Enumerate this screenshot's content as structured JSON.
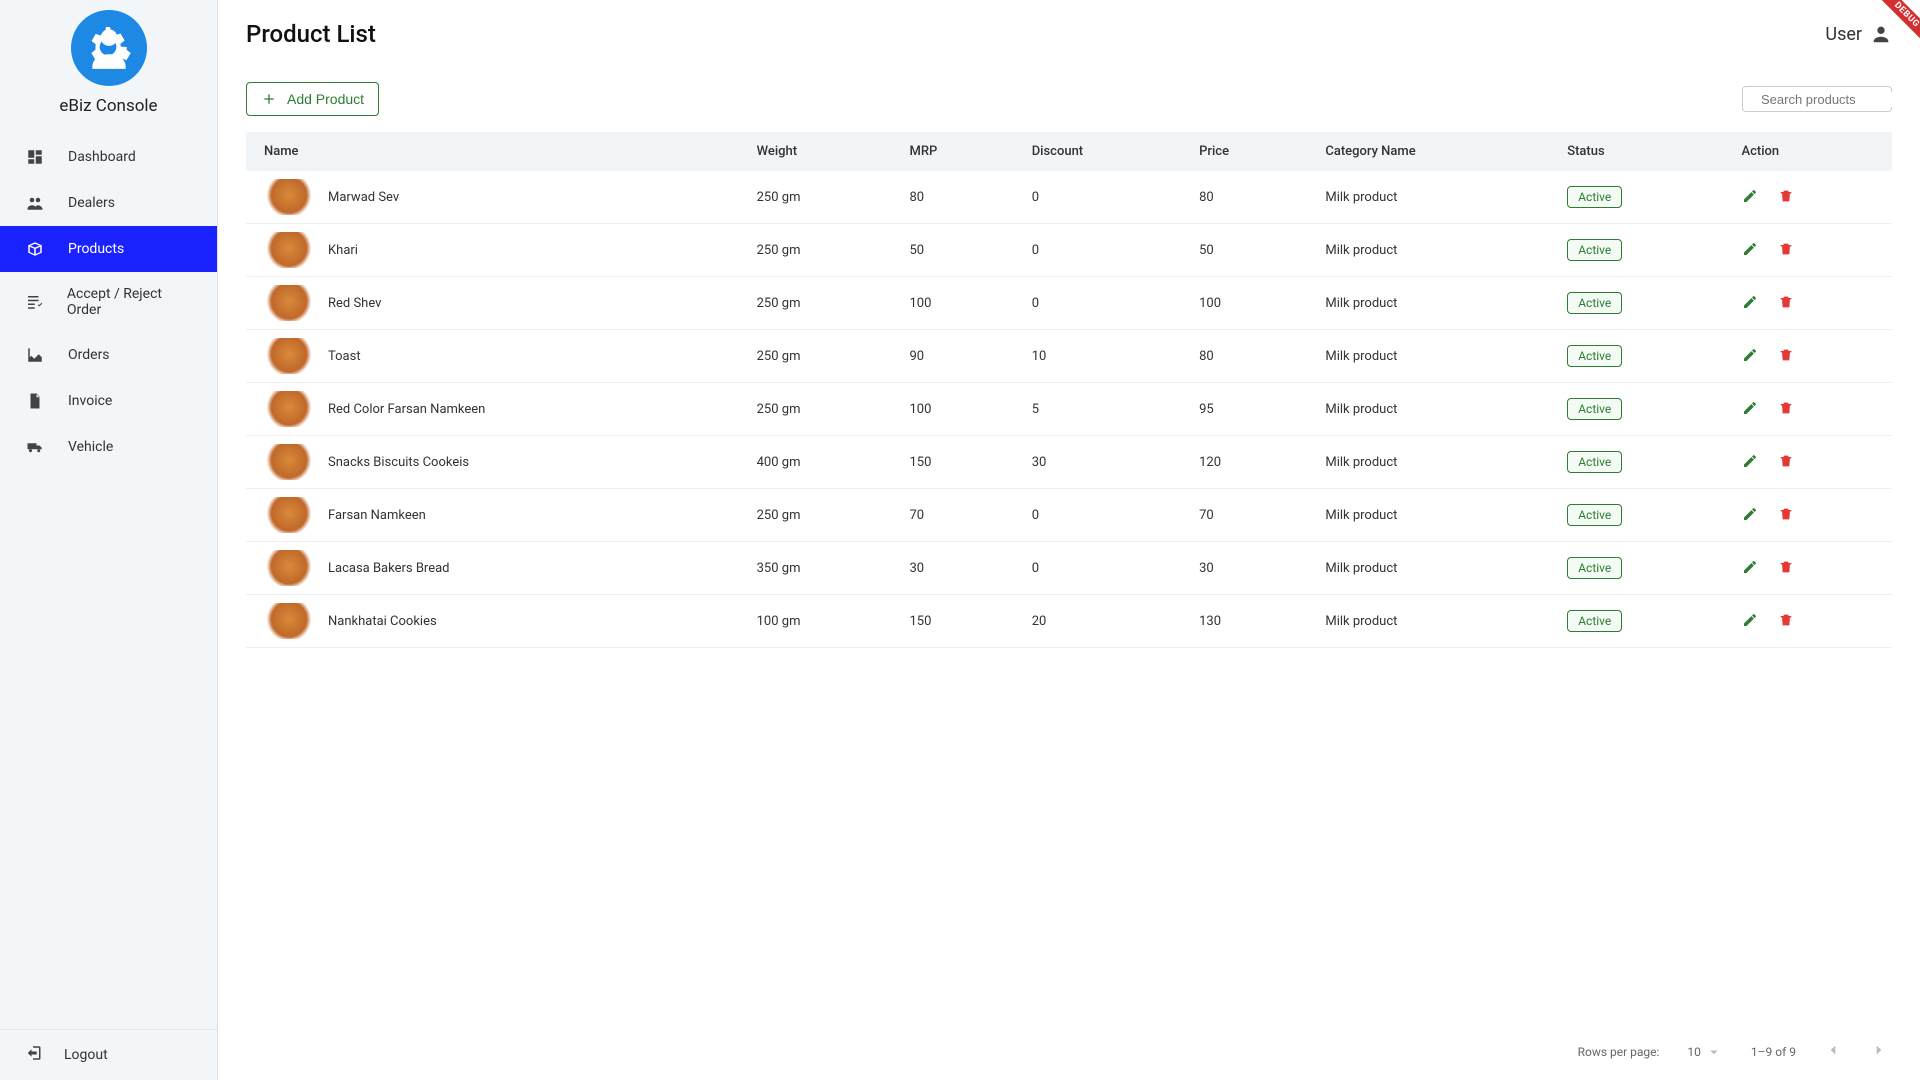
{
  "brand": "eBiz Console",
  "debug_label": "DEBUG",
  "header": {
    "title": "Product List",
    "user_label": "User"
  },
  "sidebar": {
    "items": [
      {
        "label": "Dashboard",
        "icon": "dashboard-icon"
      },
      {
        "label": "Dealers",
        "icon": "people-icon"
      },
      {
        "label": "Products",
        "icon": "box-icon",
        "active": true
      },
      {
        "label": "Accept / Reject Order",
        "icon": "checklist-icon"
      },
      {
        "label": "Orders",
        "icon": "chart-icon"
      },
      {
        "label": "Invoice",
        "icon": "document-icon"
      },
      {
        "label": "Vehicle",
        "icon": "truck-icon"
      }
    ],
    "logout_label": "Logout"
  },
  "toolbar": {
    "add_label": "Add Product",
    "search_placeholder": "Search products"
  },
  "table": {
    "columns": [
      "Name",
      "Weight",
      "MRP",
      "Discount",
      "Price",
      "Category Name",
      "Status",
      "Action"
    ],
    "rows": [
      {
        "name": "Marwad Sev",
        "weight": "250 gm",
        "mrp": "80",
        "discount": "0",
        "price": "80",
        "category": "Milk product",
        "status": "Active"
      },
      {
        "name": "Khari",
        "weight": "250 gm",
        "mrp": "50",
        "discount": "0",
        "price": "50",
        "category": "Milk product",
        "status": "Active"
      },
      {
        "name": "Red Shev",
        "weight": "250 gm",
        "mrp": "100",
        "discount": "0",
        "price": "100",
        "category": "Milk product",
        "status": "Active"
      },
      {
        "name": "Toast",
        "weight": "250 gm",
        "mrp": "90",
        "discount": "10",
        "price": "80",
        "category": "Milk product",
        "status": "Active"
      },
      {
        "name": "Red Color Farsan Namkeen",
        "weight": "250 gm",
        "mrp": "100",
        "discount": "5",
        "price": "95",
        "category": "Milk product",
        "status": "Active"
      },
      {
        "name": "Snacks Biscuits Cookeis",
        "weight": "400 gm",
        "mrp": "150",
        "discount": "30",
        "price": "120",
        "category": "Milk product",
        "status": "Active"
      },
      {
        "name": "Farsan Namkeen",
        "weight": "250 gm",
        "mrp": "70",
        "discount": "0",
        "price": "70",
        "category": "Milk product",
        "status": "Active"
      },
      {
        "name": "Lacasa Bakers Bread",
        "weight": "350 gm",
        "mrp": "30",
        "discount": "0",
        "price": "30",
        "category": "Milk product",
        "status": "Active"
      },
      {
        "name": "Nankhatai Cookies",
        "weight": "100 gm",
        "mrp": "150",
        "discount": "20",
        "price": "130",
        "category": "Milk product",
        "status": "Active"
      }
    ]
  },
  "pager": {
    "rows_per_page_label": "Rows per page:",
    "rows_per_page_value": "10",
    "range_label": "1–9 of 9"
  }
}
